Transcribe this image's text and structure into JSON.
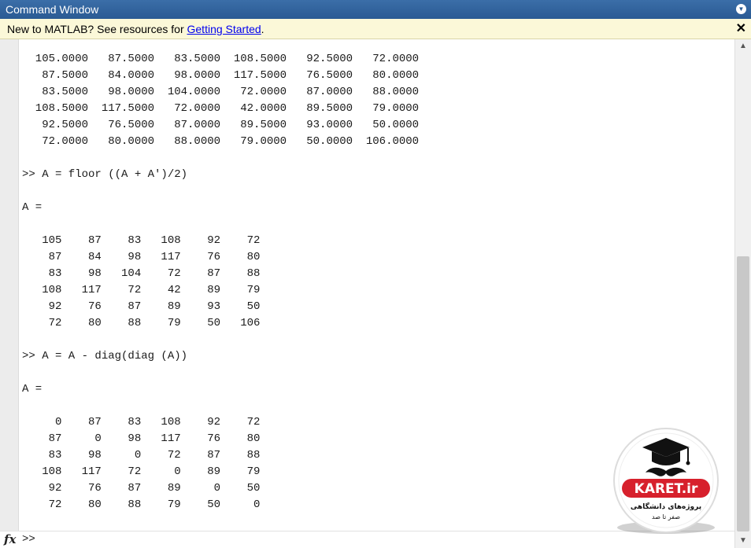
{
  "window": {
    "title": "Command Window",
    "menu_icon": "chevron-down-icon"
  },
  "notice": {
    "prefix": "New to MATLAB? See resources for ",
    "link": "Getting Started",
    "suffix": ".",
    "close": "✕"
  },
  "console": {
    "lines": [
      "  105.0000   87.5000   83.5000  108.5000   92.5000   72.0000",
      "   87.5000   84.0000   98.0000  117.5000   76.5000   80.0000",
      "   83.5000   98.0000  104.0000   72.0000   87.0000   88.0000",
      "  108.5000  117.5000   72.0000   42.0000   89.5000   79.0000",
      "   92.5000   76.5000   87.0000   89.5000   93.0000   50.0000",
      "   72.0000   80.0000   88.0000   79.0000   50.0000  106.0000",
      "",
      ">> A = floor ((A + A')/2)",
      "",
      "A =",
      "",
      "   105    87    83   108    92    72",
      "    87    84    98   117    76    80",
      "    83    98   104    72    87    88",
      "   108   117    72    42    89    79",
      "    92    76    87    89    93    50",
      "    72    80    88    79    50   106",
      "",
      ">> A = A - diag(diag (A))",
      "",
      "A =",
      "",
      "     0    87    83   108    92    72",
      "    87     0    98   117    76    80",
      "    83    98     0    72    87    88",
      "   108   117    72     0    89    79",
      "    92    76    87    89     0    50",
      "    72    80    88    79    50     0"
    ]
  },
  "prompt": {
    "fx_label": "fx",
    "text": ">>"
  },
  "watermark": {
    "brand": "KARET.ir",
    "tagline_line1": "پروژه‌های دانشگاهی",
    "tagline_line2": "صفر تا صد"
  },
  "colors": {
    "title_bar": "#2a5a93",
    "notice_bg": "#fbf8d8",
    "link": "#0000ee",
    "logo_red": "#d7202c"
  }
}
